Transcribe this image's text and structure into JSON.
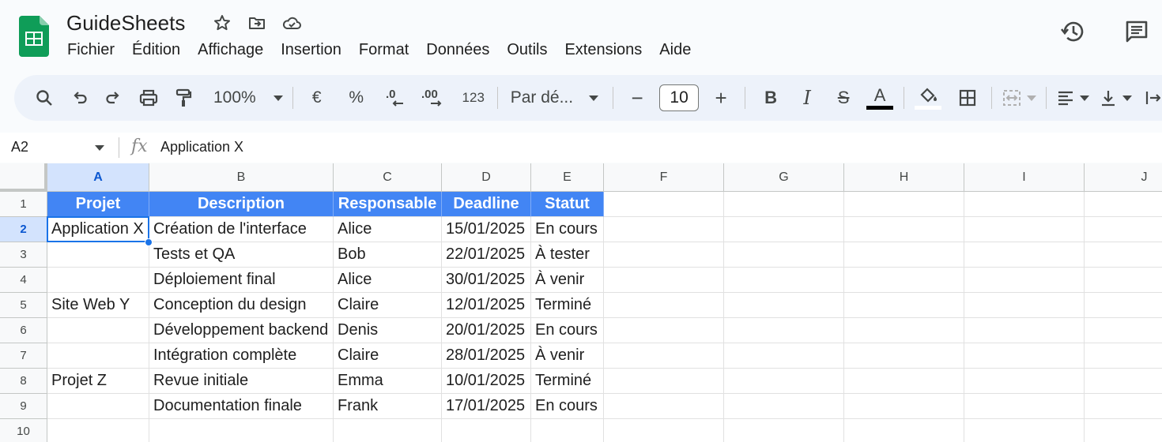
{
  "app": {
    "title": "GuideSheets",
    "menu": [
      "Fichier",
      "Édition",
      "Affichage",
      "Insertion",
      "Format",
      "Données",
      "Outils",
      "Extensions",
      "Aide"
    ]
  },
  "toolbar": {
    "zoom": "100%",
    "currency": "€",
    "percent": "%",
    "decrease_decimals": ".0",
    "increase_decimals": ".00",
    "number_format": "123",
    "font": "Par dé...",
    "font_size": "10",
    "minus": "−",
    "plus": "+",
    "bold": "B",
    "italic": "I",
    "strikethrough": "S",
    "text_color": "A"
  },
  "formula_bar": {
    "cell_ref": "A2",
    "fx": "fx",
    "content": "Application X"
  },
  "grid": {
    "columns": [
      "A",
      "B",
      "C",
      "D",
      "E",
      "F",
      "G",
      "H",
      "I",
      "J"
    ],
    "rows": [
      "1",
      "2",
      "3",
      "4",
      "5",
      "6",
      "7",
      "8",
      "9",
      "10"
    ],
    "selected_column": "A",
    "selected_row": "2",
    "header_fill": "#4285f4",
    "cells": [
      [
        "Projet",
        "Description",
        "Responsable",
        "Deadline",
        "Statut"
      ],
      [
        "Application X",
        "Création de l'interface",
        "Alice",
        "15/01/2025",
        "En cours"
      ],
      [
        "",
        "Tests et QA",
        "Bob",
        "22/01/2025",
        "À tester"
      ],
      [
        "",
        "Déploiement final",
        "Alice",
        "30/01/2025",
        "À venir"
      ],
      [
        "Site Web Y",
        "Conception du design",
        "Claire",
        "12/01/2025",
        "Terminé"
      ],
      [
        "",
        "Développement backend",
        "Denis",
        "20/01/2025",
        "En cours"
      ],
      [
        "",
        "Intégration complète",
        "Claire",
        "28/01/2025",
        "À venir"
      ],
      [
        "Projet Z",
        "Revue initiale",
        "Emma",
        "10/01/2025",
        "Terminé"
      ],
      [
        "",
        "Documentation finale",
        "Frank",
        "17/01/2025",
        "En cours"
      ]
    ]
  }
}
